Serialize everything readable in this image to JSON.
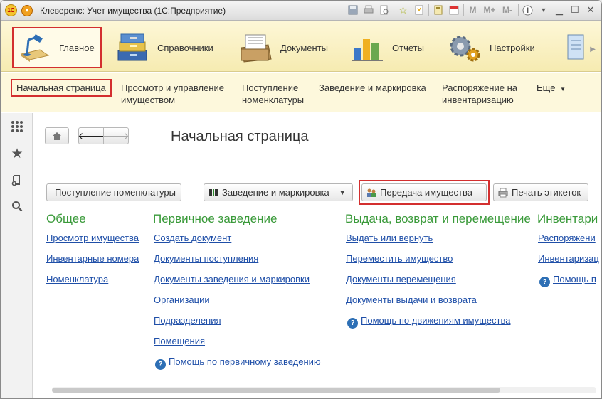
{
  "window": {
    "title": "Клеверенс: Учет имущества  (1С:Предприятие)",
    "logo_text": "1С"
  },
  "titlebar_icons": [
    "save-icon",
    "print-icon",
    "preview-icon",
    "favorite-icon",
    "bookmark-icon",
    "calculator-icon",
    "calendar-icon"
  ],
  "titlebar_mem": {
    "m": "M",
    "m_plus": "M+",
    "m_minus": "M-"
  },
  "sections": [
    {
      "label": "Главное",
      "icon": "home-lamp-icon",
      "active": true
    },
    {
      "label": "Справочники",
      "icon": "folders-icon",
      "active": false
    },
    {
      "label": "Документы",
      "icon": "documents-icon",
      "active": false
    },
    {
      "label": "Отчеты",
      "icon": "chart-icon",
      "active": false
    },
    {
      "label": "Настройки",
      "icon": "gears-icon",
      "active": false
    }
  ],
  "commands": [
    {
      "label": "Начальная страница"
    },
    {
      "label": "Просмотр и управление\nимуществом"
    },
    {
      "label": "Поступление\nноменклатуры"
    },
    {
      "label": "Заведение и маркировка"
    },
    {
      "label": "Распоряжение на\nинвентаризацию"
    },
    {
      "label": "Еще"
    }
  ],
  "main": {
    "title": "Начальная страница",
    "buttons": [
      {
        "label": "Поступление номенклатуры"
      },
      {
        "label": "Заведение и маркировка"
      },
      {
        "label": "Передача имущества"
      },
      {
        "label": "Печать этикеток"
      }
    ],
    "groups": [
      {
        "title": "Общее",
        "links": [
          "Просмотр имущества",
          "Инвентарные номера",
          "Номенклатура"
        ]
      },
      {
        "title": "Первичное заведение",
        "links": [
          "Создать документ",
          "Документы поступления",
          "Документы заведения и маркировки",
          "Организации",
          "Подразделения",
          "Помещения"
        ],
        "help": "Помощь по первичному заведению"
      },
      {
        "title": "Выдача, возврат и перемещение",
        "links": [
          "Выдать или вернуть",
          "Переместить имущество",
          "Документы перемещения",
          "Документы выдачи и возврата"
        ],
        "help": "Помощь по движениям имущества"
      },
      {
        "title": "Инвентари",
        "links": [
          "Распоряжени",
          "Инвентаризац"
        ],
        "help": "Помощь п"
      }
    ]
  },
  "colors": {
    "accent_red": "#d32f2f",
    "group_title_green": "#3a9a3a",
    "link_blue": "#1f4fa8",
    "sections_bg": "#f6ebb1"
  }
}
